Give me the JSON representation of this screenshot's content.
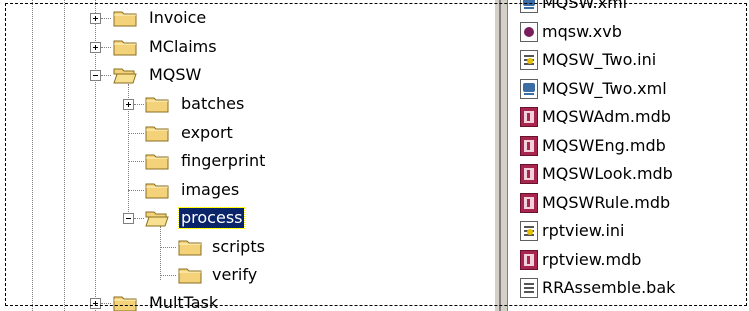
{
  "tree": {
    "nodes": [
      {
        "label": "Invoice",
        "expander": "plus"
      },
      {
        "label": "MClaims",
        "expander": "plus"
      },
      {
        "label": "MQSW",
        "expander": "minus"
      },
      {
        "label": "batches",
        "expander": "plus"
      },
      {
        "label": "export"
      },
      {
        "label": "fingerprint"
      },
      {
        "label": "images"
      },
      {
        "label": "process",
        "expander": "minus",
        "selected": true
      },
      {
        "label": "scripts"
      },
      {
        "label": "verify"
      },
      {
        "label": "MultTask",
        "expander": "plus"
      }
    ]
  },
  "files": [
    {
      "name": "MQSW.xml",
      "icon": "xml-file-icon"
    },
    {
      "name": "mqsw.xvb",
      "icon": "xvb-file-icon"
    },
    {
      "name": "MQSW_Two.ini",
      "icon": "ini-file-icon"
    },
    {
      "name": "MQSW_Two.xml",
      "icon": "xml-file-icon"
    },
    {
      "name": "MQSWAdm.mdb",
      "icon": "access-db-icon"
    },
    {
      "name": "MQSWEng.mdb",
      "icon": "access-db-icon"
    },
    {
      "name": "MQSWLook.mdb",
      "icon": "access-db-icon"
    },
    {
      "name": "MQSWRule.mdb",
      "icon": "access-db-icon"
    },
    {
      "name": "rptview.ini",
      "icon": "ini-file-icon"
    },
    {
      "name": "rptview.mdb",
      "icon": "access-db-icon"
    },
    {
      "name": "RRAssemble.bak",
      "icon": "bak-file-icon"
    }
  ],
  "colors": {
    "selection": "#0a246a",
    "folder": "#f4d27a",
    "window": "#ffffff",
    "splitter": "#d4d0c8"
  }
}
